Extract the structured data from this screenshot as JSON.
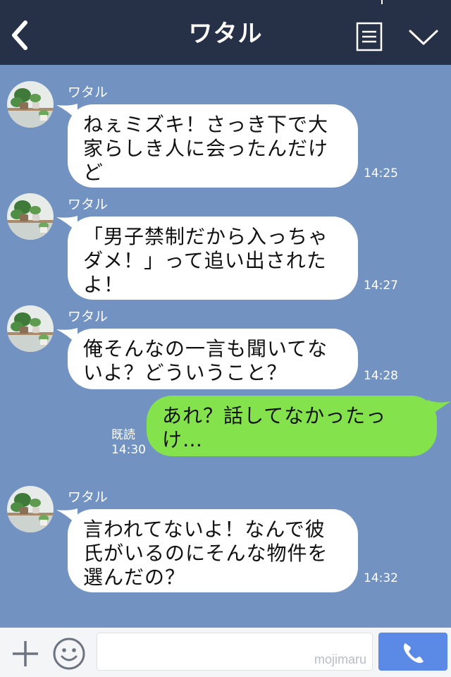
{
  "header": {
    "title": "ワタル",
    "back_icon": "chevron-left-icon",
    "menu_icon": "list-icon",
    "collapse_icon": "chevron-down-icon"
  },
  "messages": [
    {
      "sender": "ワタル",
      "side": "left",
      "text": "ねぇミズキ！さっき下で大家らしき人に会ったんだけど",
      "time": "14:25"
    },
    {
      "sender": "ワタル",
      "side": "left",
      "text": "「男子禁制だから入っちゃダメ！」って追い出されたよ！",
      "time": "14:27"
    },
    {
      "sender": "ワタル",
      "side": "left",
      "text": "俺そんなの一言も聞いてないよ？どういうこと？",
      "time": "14:28"
    },
    {
      "sender": "",
      "side": "right",
      "text": "あれ？話してなかったっけ…",
      "read_label": "既読",
      "time": "14:30"
    },
    {
      "sender": "ワタル",
      "side": "left",
      "text": "言われてないよ！なんで彼氏がいるのにそんな物件を選んだの？",
      "time": "14:32"
    }
  ],
  "footer": {
    "plus_icon": "plus-icon",
    "emoji_icon": "emoji-icon",
    "input_value": "",
    "watermark": "mojimaru",
    "call_icon": "phone-icon"
  },
  "colors": {
    "header_bg": "#263147",
    "chat_bg": "#7293c2",
    "own_bubble": "#84e34d",
    "other_bubble": "#ffffff",
    "call_button": "#5b8ae6"
  }
}
